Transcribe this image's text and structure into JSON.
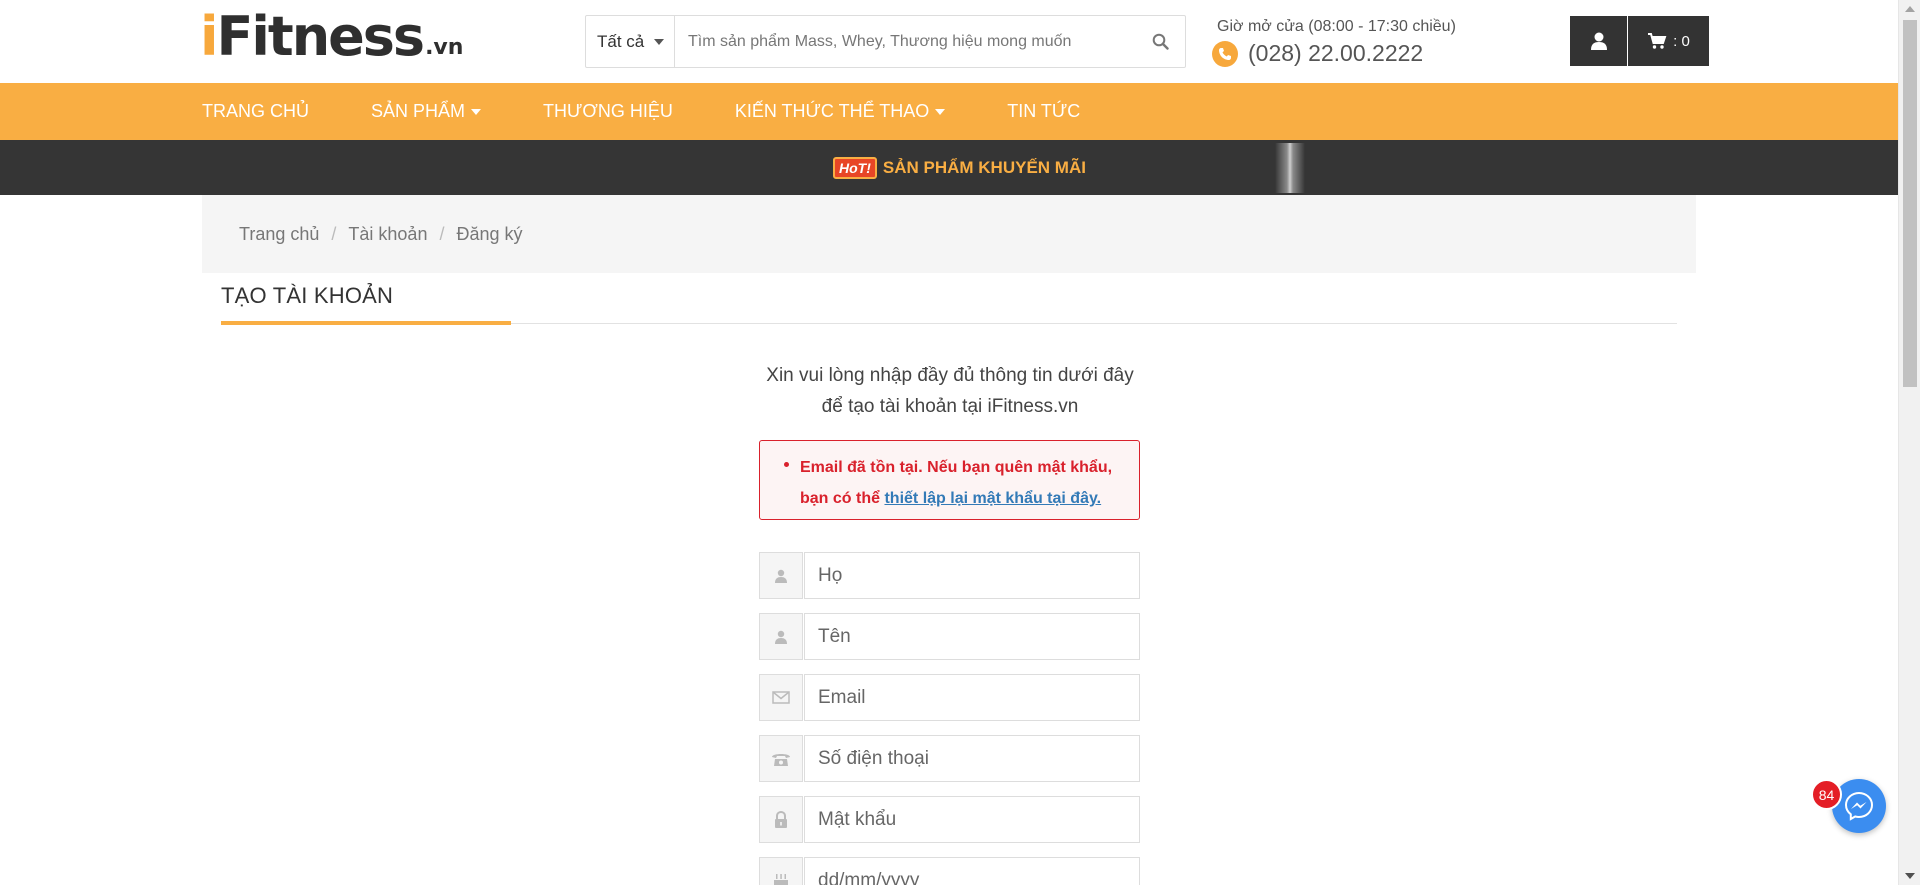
{
  "header": {
    "logo": {
      "prefix": "i",
      "name": "Fitness",
      "suffix": ".vn"
    },
    "search": {
      "category": "Tất cả",
      "placeholder": "Tìm sản phẩm Mass, Whey, Thương hiệu mong muốn"
    },
    "hours": "Giờ mở cửa (08:00 - 17:30 chiều)",
    "phone": "(028) 22.00.2222",
    "cart_count": ": 0"
  },
  "nav": {
    "items": [
      {
        "label": "TRANG CHỦ",
        "dropdown": false
      },
      {
        "label": "SẢN PHẨM",
        "dropdown": true
      },
      {
        "label": "THƯƠNG HIỆU",
        "dropdown": false
      },
      {
        "label": "KIẾN THỨC THỂ THAO",
        "dropdown": true
      },
      {
        "label": "TIN TỨC",
        "dropdown": false
      }
    ]
  },
  "promo": {
    "badge": "HoT!",
    "text": "SẢN PHẨM KHUYẾN MÃI"
  },
  "breadcrumb": [
    "Trang chủ",
    "Tài khoản",
    "Đăng ký"
  ],
  "page_title": "TẠO TÀI KHOẢN",
  "form": {
    "intro_line1": "Xin vui lòng nhập đầy đủ thông tin dưới đây",
    "intro_line2": "để tạo tài khoản tại iFitness.vn",
    "error": {
      "text": "Email đã tồn tại. Nếu bạn quên mật khẩu, bạn có thể",
      "link": "thiết lập lại mật khẩu tại đây."
    },
    "fields": [
      {
        "name": "last-name",
        "icon": "user-icon",
        "placeholder": "Họ"
      },
      {
        "name": "first-name",
        "icon": "user-icon",
        "placeholder": "Tên"
      },
      {
        "name": "email",
        "icon": "envelope-icon",
        "placeholder": "Email"
      },
      {
        "name": "phone",
        "icon": "telephone-icon",
        "placeholder": "Số điện thoại"
      },
      {
        "name": "password",
        "icon": "lock-icon",
        "placeholder": "Mật khẩu"
      },
      {
        "name": "birthday",
        "icon": "cake-icon",
        "placeholder": "dd/mm/yyyy"
      }
    ]
  },
  "messenger": {
    "badge_count": "84"
  },
  "colors": {
    "accent": "#f9ae43",
    "dark": "#353535",
    "error": "#d9212c",
    "link": "#337ab7"
  }
}
